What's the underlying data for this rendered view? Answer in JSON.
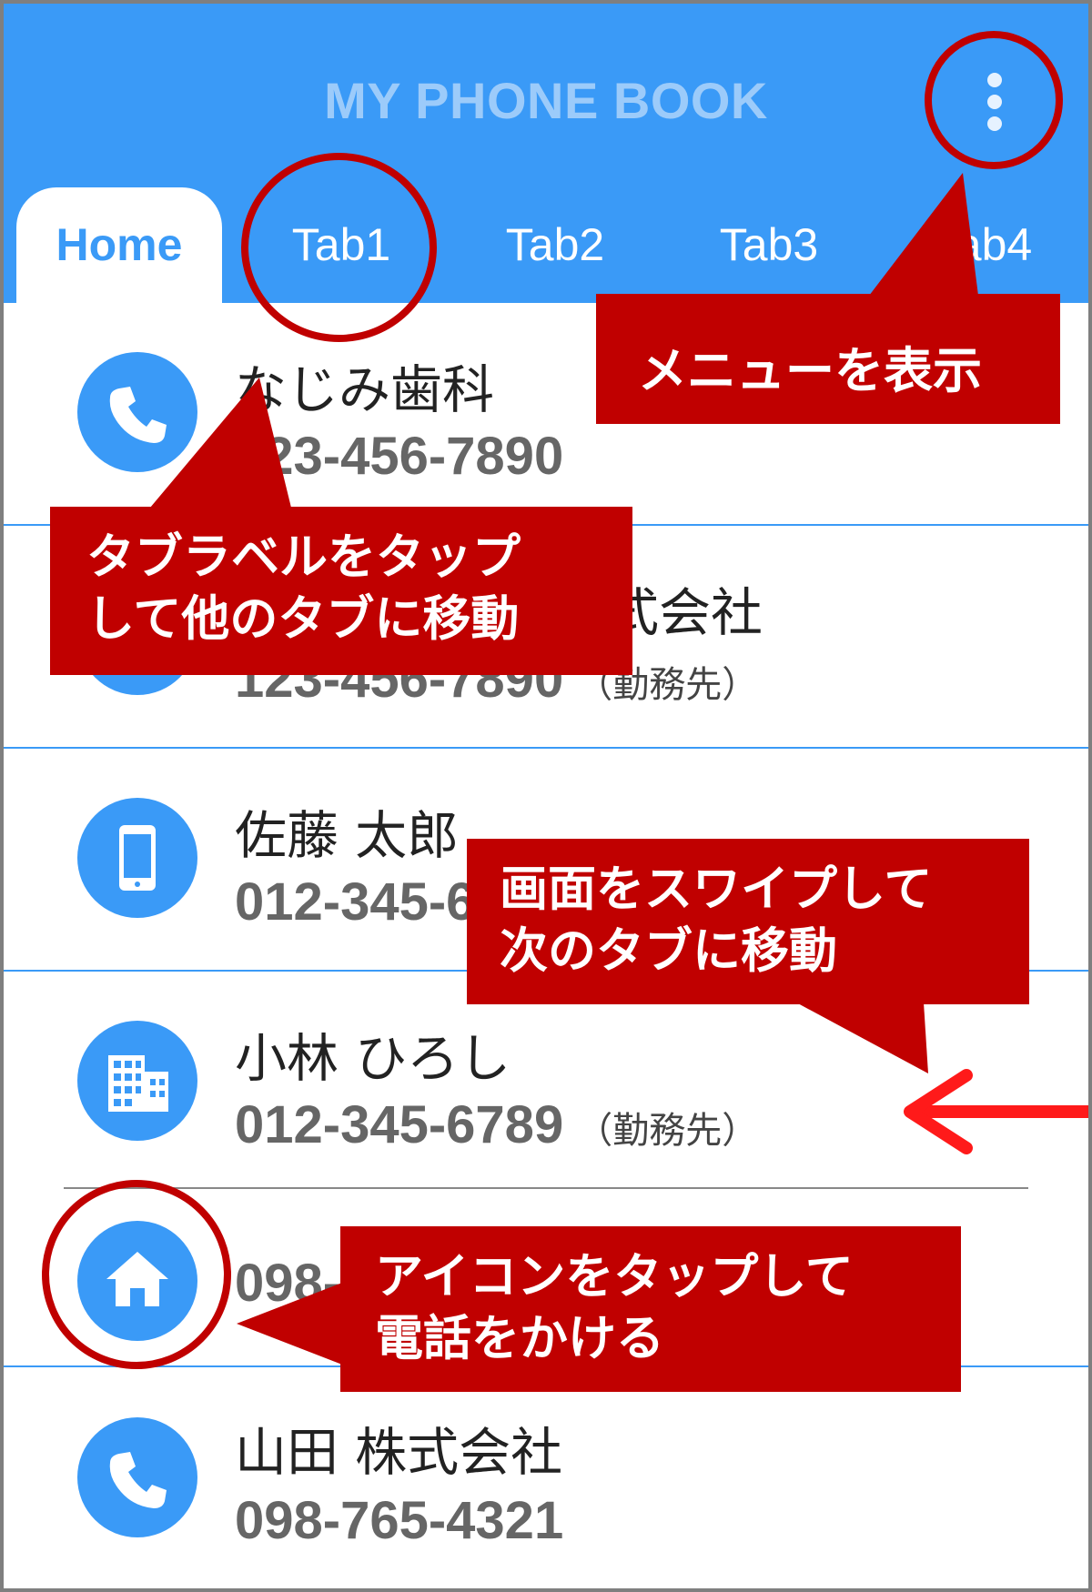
{
  "app": {
    "title": "MY PHONE BOOK",
    "overflow_menu_icon": "more-vert-icon"
  },
  "tabs": [
    {
      "label": "Home",
      "active": true
    },
    {
      "label": "Tab1",
      "active": false
    },
    {
      "label": "Tab2",
      "active": false
    },
    {
      "label": "Tab3",
      "active": false
    },
    {
      "label": "Tab4",
      "active": false
    }
  ],
  "contacts": [
    {
      "name": "なじみ歯科",
      "phone": "123-456-7890",
      "note": "",
      "icon": "phone-icon"
    },
    {
      "name": "株式会社",
      "phone": "123-456-7890",
      "note": "（勤務先）",
      "icon": "phone-icon"
    },
    {
      "name": "佐藤 太郎",
      "phone": "012-345-6789",
      "note": "",
      "icon": "smartphone-icon"
    },
    {
      "name": "小林 ひろし",
      "phone": "012-345-6789",
      "note": "（勤務先）",
      "icon": "office-building-icon"
    },
    {
      "name": "",
      "phone": "098-765-4321",
      "note": "",
      "icon": "home-icon"
    },
    {
      "name": "山田 株式会社",
      "phone": "098-765-4321",
      "note": "",
      "icon": "phone-icon"
    }
  ],
  "annotations": {
    "menu": "メニューを表示",
    "tab_tap": [
      "タブラベルをタップ",
      "して他のタブに移動"
    ],
    "swipe": [
      "画面をスワイプして",
      "次のタブに移動"
    ],
    "icon_tap": [
      "アイコンをタップして",
      "電話をかける"
    ]
  },
  "colors": {
    "primary": "#3a9af7",
    "annotation": "#c00000",
    "swipe_arrow": "#ff1a1a"
  }
}
